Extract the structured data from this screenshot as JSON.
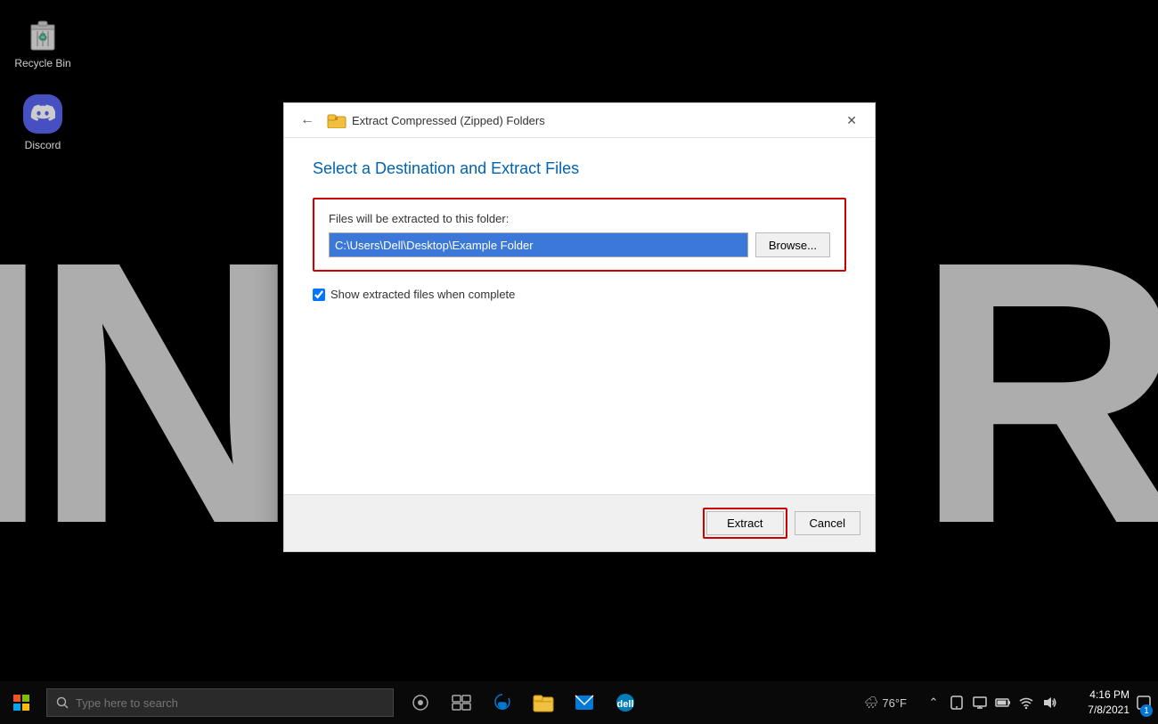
{
  "desktop": {
    "bg_letters_left": "IN",
    "bg_letters_right": "R"
  },
  "desktop_icons": [
    {
      "id": "recycle-bin",
      "label": "Recycle Bin",
      "type": "recycle-bin"
    },
    {
      "id": "discord",
      "label": "Discord",
      "type": "discord"
    }
  ],
  "dialog": {
    "title": "Extract Compressed (Zipped) Folders",
    "section_title": "Select a Destination and Extract Files",
    "extract_label": "Files will be extracted to this folder:",
    "extract_path": "C:\\Users\\Dell\\Desktop\\Example Folder",
    "browse_label": "Browse...",
    "checkbox_label": "Show extracted files when complete",
    "checkbox_checked": true,
    "extract_button": "Extract",
    "cancel_button": "Cancel",
    "close_button": "✕"
  },
  "taskbar": {
    "search_placeholder": "Type here to search",
    "clock": {
      "time": "4:16 PM",
      "date": "7/8/2021"
    },
    "weather": "76°F",
    "notification_count": "1"
  }
}
